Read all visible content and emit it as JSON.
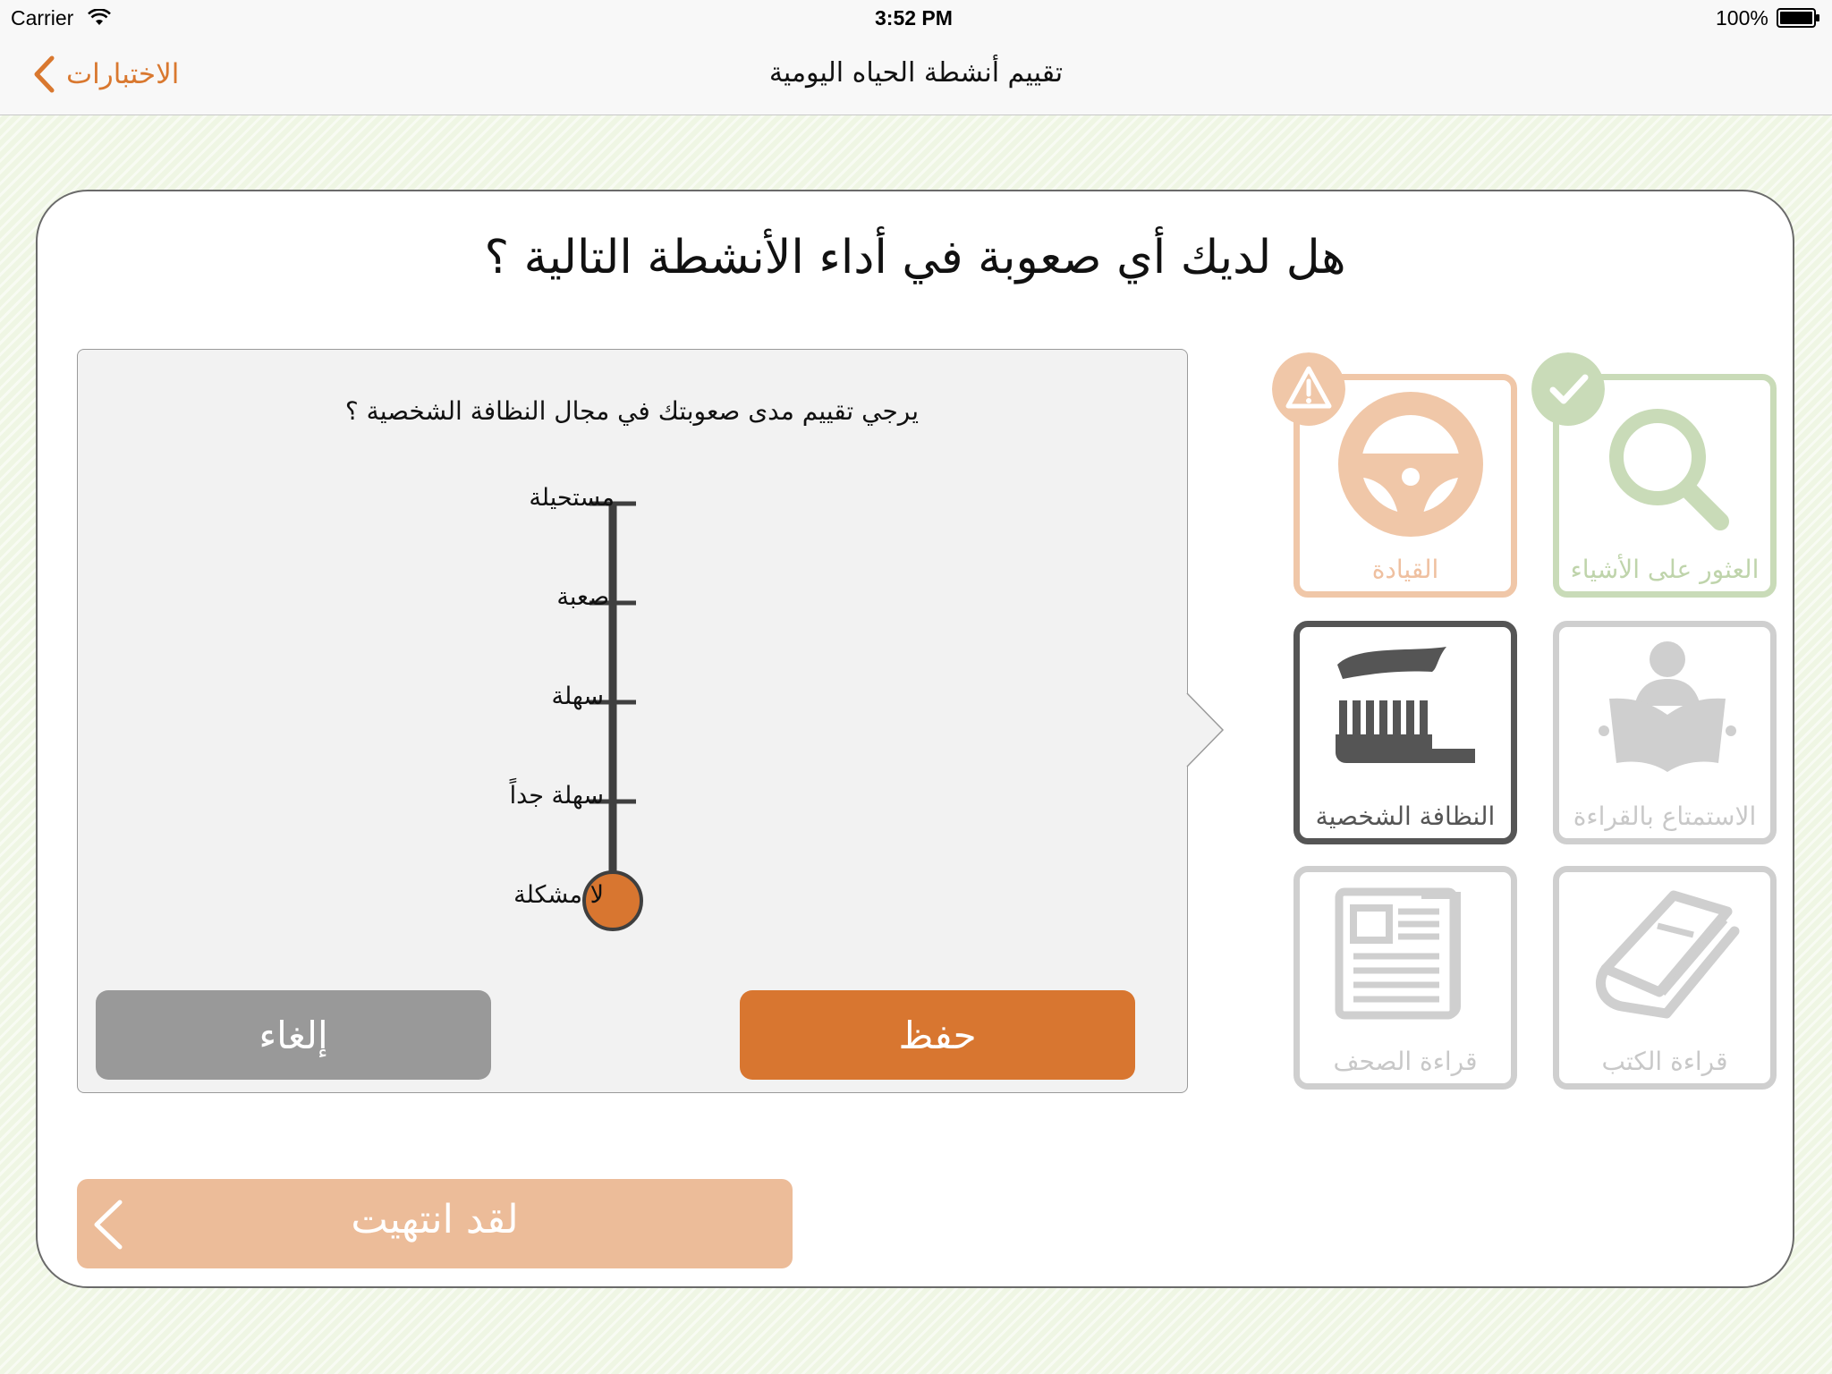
{
  "status_bar": {
    "carrier": "Carrier",
    "time": "3:52 PM",
    "battery": "100%"
  },
  "nav": {
    "back_label": "الاختبارات",
    "title": "تقييم أنشطة الحياه اليومية"
  },
  "question": "هل لديك أي صعوبة في أداء الأنشطة التالية ؟",
  "popover": {
    "prompt": "يرجي تقييم مدى صعوبتك في مجال النظافة الشخصية ؟",
    "scale": [
      "مستحيلة",
      "صعبة",
      "سهلة",
      "سهلة جداً",
      "لا مشكلة"
    ],
    "selected": "لا مشكلة",
    "cancel_label": "إلغاء",
    "save_label": "حفظ"
  },
  "activities": [
    {
      "label": "القيادة",
      "icon": "steering-wheel-icon",
      "status": "warning"
    },
    {
      "label": "العثور على الأشياء",
      "icon": "magnifier-icon",
      "status": "done"
    },
    {
      "label": "النظافة الشخصية",
      "icon": "toothbrush-icon",
      "status": "selected"
    },
    {
      "label": "الاستمتاع بالقراءة",
      "icon": "reading-person-icon",
      "status": "inactive"
    },
    {
      "label": "قراءة الصحف",
      "icon": "newspaper-icon",
      "status": "inactive"
    },
    {
      "label": "قراءة الكتب",
      "icon": "book-icon",
      "status": "inactive"
    }
  ],
  "done_label": "لقد انتهيت",
  "colors": {
    "accent": "#d87630",
    "warning_tile": "#f0c7a8",
    "done_tile": "#c9dbb8",
    "selected_tile": "#555555",
    "inactive_tile": "#cfcfcf"
  }
}
